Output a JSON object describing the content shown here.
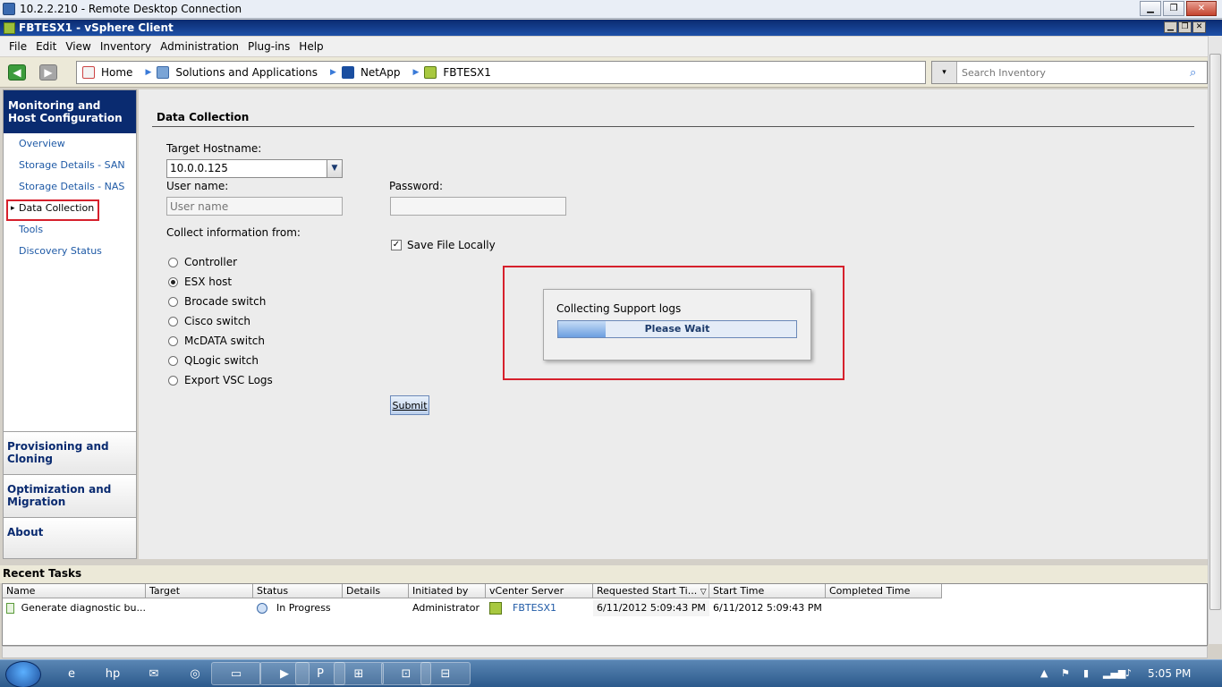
{
  "rdp": {
    "title": "10.2.2.210 - Remote Desktop Connection"
  },
  "app": {
    "title": "FBTESX1 - vSphere Client"
  },
  "menu": [
    "File",
    "Edit",
    "View",
    "Inventory",
    "Administration",
    "Plug-ins",
    "Help"
  ],
  "breadcrumb": [
    "Home",
    "Solutions and Applications",
    "NetApp",
    "FBTESX1"
  ],
  "search": {
    "placeholder": "Search Inventory"
  },
  "sidebar": {
    "header": "Monitoring and Host Configuration",
    "items": [
      "Overview",
      "Storage Details - SAN",
      "Storage Details - NAS",
      "Data Collection",
      "Tools",
      "Discovery Status"
    ],
    "active": "Data Collection",
    "sections": [
      "Provisioning and Cloning",
      "Optimization and Migration",
      "About"
    ]
  },
  "form": {
    "title": "Data Collection",
    "target_label": "Target Hostname:",
    "target_value": "10.0.0.125",
    "username_label": "User name:",
    "username_placeholder": "User name",
    "password_label": "Password:",
    "collect_label": "Collect information from:",
    "options": [
      "Controller",
      "ESX host",
      "Brocade switch",
      "Cisco switch",
      "McDATA switch",
      "QLogic switch",
      "Export VSC Logs"
    ],
    "selected": "ESX host",
    "save_local_label": "Save File Locally",
    "save_local_checked": true,
    "submit_label": "Submit"
  },
  "dialog": {
    "message": "Collecting Support logs",
    "progress_text": "Please Wait",
    "progress": 0.2
  },
  "tasks": {
    "title": "Recent Tasks",
    "columns": [
      "Name",
      "Target",
      "Status",
      "Details",
      "Initiated by",
      "vCenter Server",
      "Requested Start Ti...",
      "Start Time",
      "Completed Time"
    ],
    "rows": [
      {
        "name": "Generate diagnostic bu...",
        "target": "",
        "status": "In Progress",
        "details": "",
        "initiated_by": "Administrator",
        "vcenter": "FBTESX1",
        "requested": "6/11/2012 5:09:43 PM",
        "start": "6/11/2012 5:09:43 PM",
        "completed": ""
      }
    ]
  },
  "taskbar": {
    "clock": "5:05 PM"
  },
  "colors": {
    "accent": "#0a2b70",
    "highlight": "#d6202c",
    "link": "#1f5aa6"
  }
}
